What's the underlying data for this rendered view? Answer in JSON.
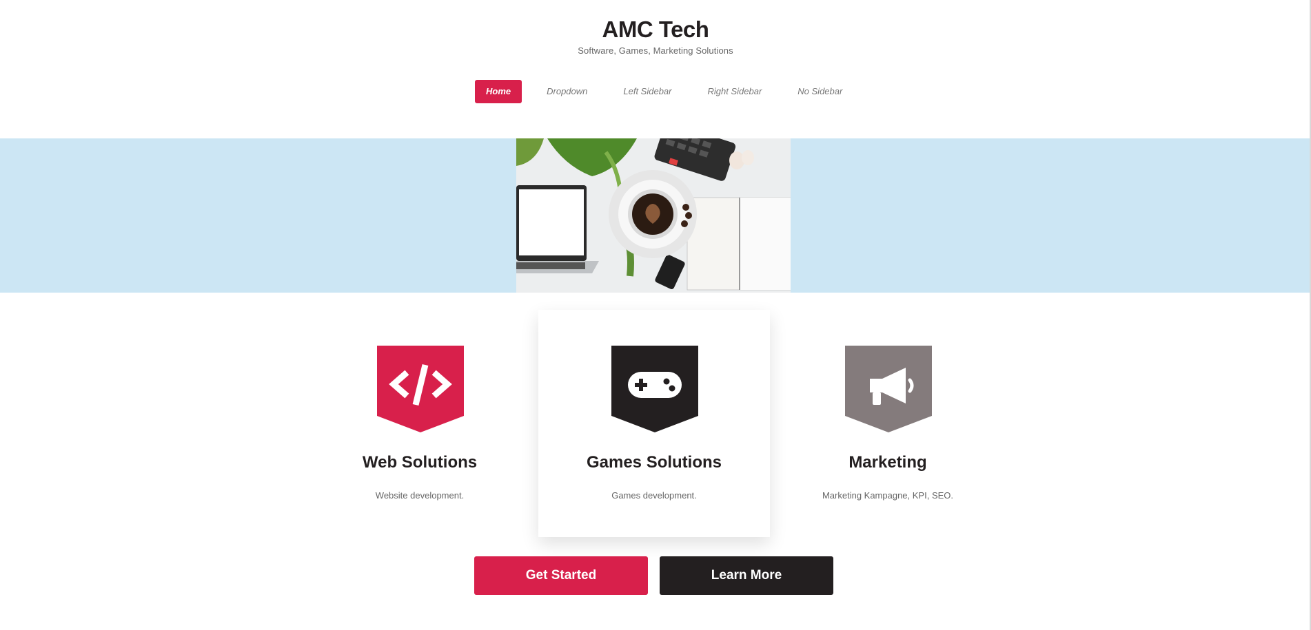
{
  "header": {
    "title": "AMC Tech",
    "tagline": "Software, Games, Marketing Solutions"
  },
  "nav": {
    "items": [
      {
        "label": "Home",
        "active": true
      },
      {
        "label": "Dropdown"
      },
      {
        "label": "Left Sidebar"
      },
      {
        "label": "Right Sidebar"
      },
      {
        "label": "No Sidebar"
      }
    ]
  },
  "hero": {
    "image": "desk-workspace-photo"
  },
  "features": [
    {
      "title": "Web Solutions",
      "description": "Website development.",
      "icon": "code-icon",
      "color": "#d8204b"
    },
    {
      "title": "Games Solutions",
      "description": "Games development.",
      "icon": "gamepad-icon",
      "color": "#231f20"
    },
    {
      "title": "Marketing",
      "description": "Marketing Kampagne, KPI, SEO.",
      "icon": "megaphone-icon",
      "color": "#847b7c"
    }
  ],
  "cta": {
    "primary_label": "Get Started",
    "secondary_label": "Learn More"
  },
  "colors": {
    "accent": "#d8204b",
    "dark": "#231f20",
    "muted": "#847b7c",
    "hero_bg": "#cce6f4"
  }
}
